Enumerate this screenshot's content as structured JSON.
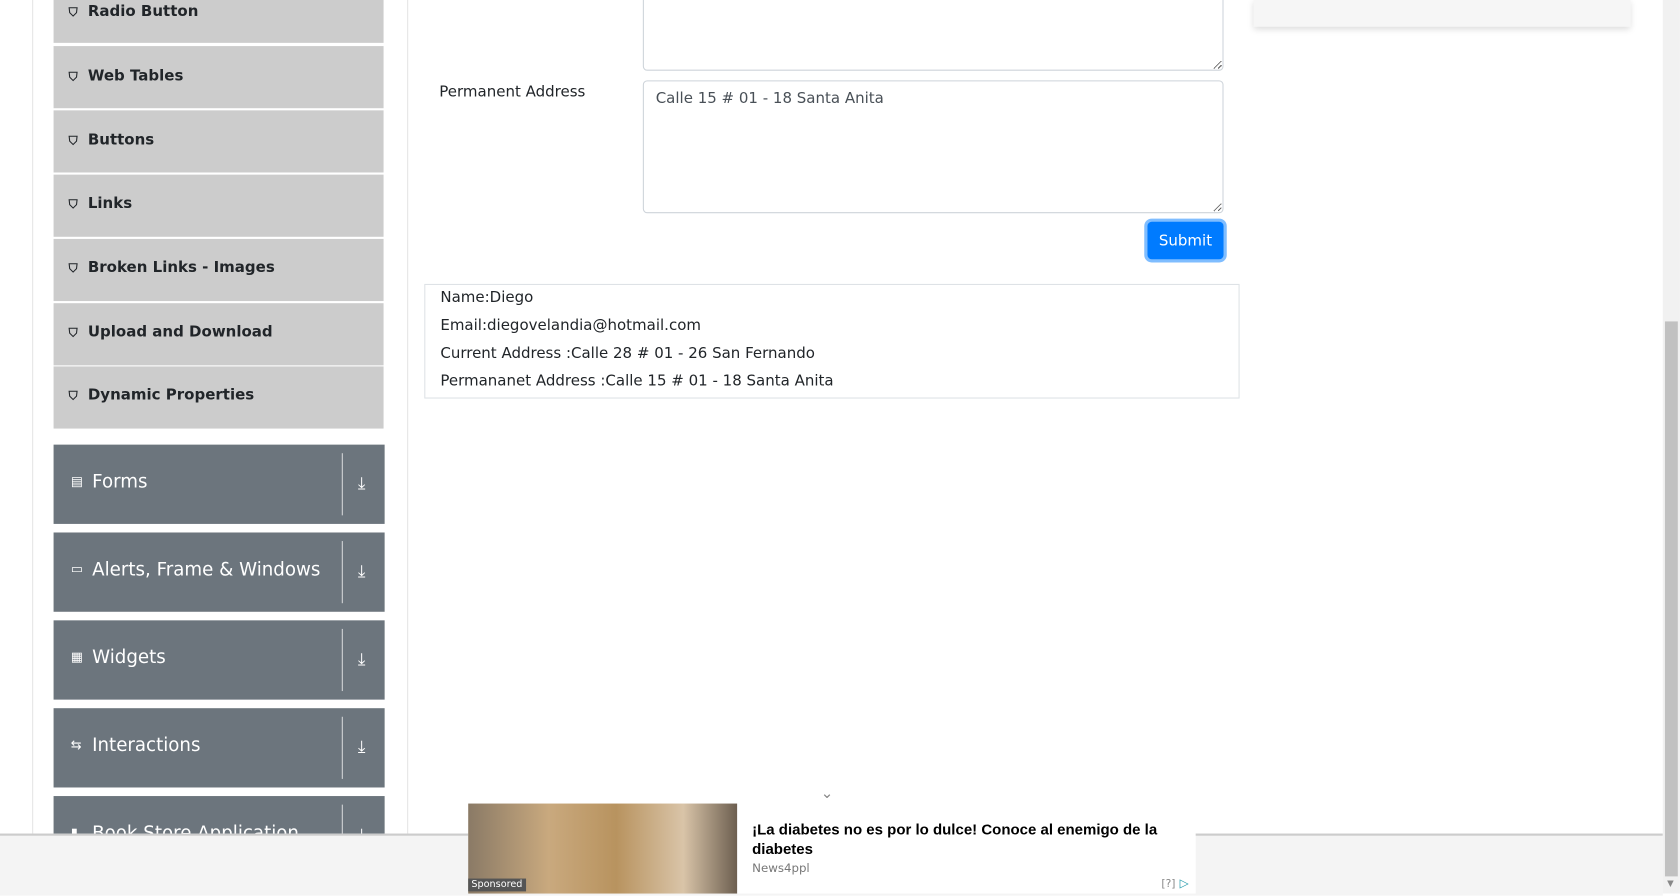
{
  "sidebar": {
    "items": [
      {
        "label": "Radio Button"
      },
      {
        "label": "Web Tables"
      },
      {
        "label": "Buttons"
      },
      {
        "label": "Links"
      },
      {
        "label": "Broken Links - Images"
      },
      {
        "label": "Upload and Download"
      },
      {
        "label": "Dynamic Properties"
      }
    ],
    "groups": [
      {
        "label": "Forms",
        "icon": "form-icon"
      },
      {
        "label": "Alerts, Frame & Windows",
        "icon": "window-icon"
      },
      {
        "label": "Widgets",
        "icon": "widgets-icon"
      },
      {
        "label": "Interactions",
        "icon": "interactions-icon"
      },
      {
        "label": "Book Store Application",
        "icon": "book-icon"
      }
    ]
  },
  "form": {
    "permanent_address_label": "Permanent Address",
    "permanent_address_value": "Calle 15 # 01 - 18 Santa Anita",
    "submit_label": "Submit",
    "accent": "#007bff"
  },
  "output": {
    "name": "Name:Diego",
    "email": "Email:diegovelandia@hotmail.com",
    "current": "Current Address :Calle 28 # 01 - 26 San Fernando",
    "permanent": "Permananet Address :Calle 15 # 01 - 18 Santa Anita"
  },
  "ad": {
    "headline": "¡La diabetes no es por lo dulce! Conoce al enemigo de la diabetes",
    "source": "News4ppl",
    "sponsored": "Sponsored",
    "info": "[?]"
  }
}
